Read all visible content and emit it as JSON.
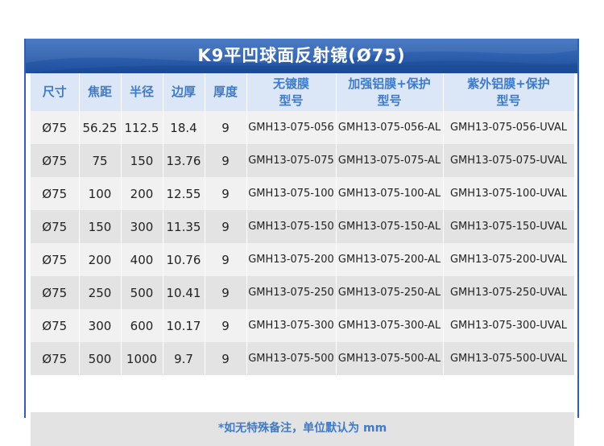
{
  "title": "K9平凹球面反射镜(Ø75)",
  "headers": [
    "尺寸",
    "焦距",
    "半径",
    "边厚",
    "厚度",
    "无镀膜\n型号",
    "加强铝膜+保护\n型号",
    "紫外铝膜+保护\n型号"
  ],
  "header_lines": [
    [
      "尺寸"
    ],
    [
      "焦距"
    ],
    [
      "半径"
    ],
    [
      "边厚"
    ],
    [
      "厚度"
    ],
    [
      "无镀膜",
      "型号"
    ],
    [
      "加强铝膜+保护",
      "型号"
    ],
    [
      "紫外铝膜+保护",
      "型号"
    ]
  ],
  "rows": [
    [
      "Ø75",
      "56.25",
      "112.5",
      "18.4",
      "9",
      "GMH13-075-056",
      "GMH13-075-056-AL",
      "GMH13-075-056-UVAL"
    ],
    [
      "Ø75",
      "75",
      "150",
      "13.76",
      "9",
      "GMH13-075-075",
      "GMH13-075-075-AL",
      "GMH13-075-075-UVAL"
    ],
    [
      "Ø75",
      "100",
      "200",
      "12.55",
      "9",
      "GMH13-075-100",
      "GMH13-075-100-AL",
      "GMH13-075-100-UVAL"
    ],
    [
      "Ø75",
      "150",
      "300",
      "11.35",
      "9",
      "GMH13-075-150",
      "GMH13-075-150-AL",
      "GMH13-075-150-UVAL"
    ],
    [
      "Ø75",
      "200",
      "400",
      "10.76",
      "9",
      "GMH13-075-200",
      "GMH13-075-200-AL",
      "GMH13-075-200-UVAL"
    ],
    [
      "Ø75",
      "250",
      "500",
      "10.41",
      "9",
      "GMH13-075-250",
      "GMH13-075-250-AL",
      "GMH13-075-250-UVAL"
    ],
    [
      "Ø75",
      "300",
      "600",
      "10.17",
      "9",
      "GMH13-075-300",
      "GMH13-075-300-AL",
      "GMH13-075-300-UVAL"
    ],
    [
      "Ø75",
      "500",
      "1000",
      "9.7",
      "9",
      "GMH13-075-500",
      "GMH13-075-500-AL",
      "GMH13-075-500-UVAL"
    ]
  ],
  "footnote": "*如无特殊备注，单位默认为 mm",
  "colors": {
    "title_bg": "#2e62ae",
    "header_bg": "#dbe7f6",
    "header_text": "#3f7bc9",
    "row_light": "#f1f1f1",
    "row_dark": "#e3e3e3",
    "footnote_text": "#3f7bc9"
  }
}
